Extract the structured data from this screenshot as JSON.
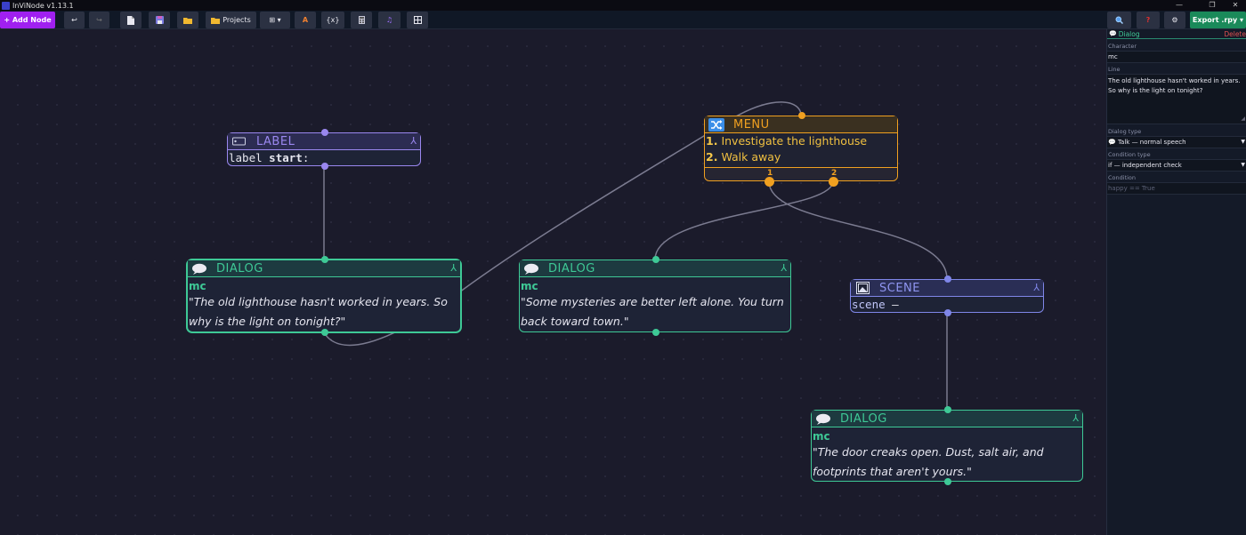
{
  "window": {
    "title": "InViNode v1.13.1",
    "controls": [
      "—",
      "❐",
      "✕"
    ]
  },
  "toolbar": {
    "add_node_label": "+ Add Node",
    "undo_icon": "↩",
    "redo_icon": "↪",
    "projects_label": "Projects",
    "grid_menu_icon": "⊞ ▾",
    "var_label": "{x}",
    "export_label": "Export .rpy ▾",
    "accent_color": "#a020f0",
    "export_color": "#1a8a5a"
  },
  "nodes": {
    "label1": {
      "title": "LABEL",
      "keyword": "label",
      "name": "start",
      "colon": ":",
      "corner": "⅄"
    },
    "dialog1": {
      "title": "DIALOG",
      "character": "mc",
      "line": "\"The old lighthouse hasn't worked in years. So why is the light on tonight?\"",
      "corner": "⅄"
    },
    "menu1": {
      "title": "MENU",
      "options": [
        {
          "num": "1.",
          "text": "Investigate the lighthouse"
        },
        {
          "num": "2.",
          "text": "Walk away"
        }
      ],
      "port_labels": [
        "1",
        "2"
      ]
    },
    "dialog2": {
      "title": "DIALOG",
      "character": "mc",
      "line": "\"Some mysteries are better left alone. You turn back toward town.\"",
      "corner": "⅄"
    },
    "scene1": {
      "title": "SCENE",
      "keyword": "scene",
      "value": "—",
      "corner": "⅄"
    },
    "dialog3": {
      "title": "DIALOG",
      "character": "mc",
      "line": "\"The door creaks open. Dust, salt air, and footprints that aren't yours.\"",
      "corner": "⅄"
    }
  },
  "panel": {
    "header_title": "Dialog",
    "delete_label": "Delete",
    "character_label": "Character",
    "character_value": "mc",
    "line_label": "Line",
    "line_value": "The old lighthouse hasn't worked in years. So why is the light on tonight?",
    "dialog_type_label": "Dialog type",
    "dialog_type_value": "💬 Talk — normal speech",
    "condition_type_label": "Condition type",
    "condition_type_value": "if — independent check",
    "condition_label": "Condition",
    "condition_placeholder": "happy == True"
  }
}
